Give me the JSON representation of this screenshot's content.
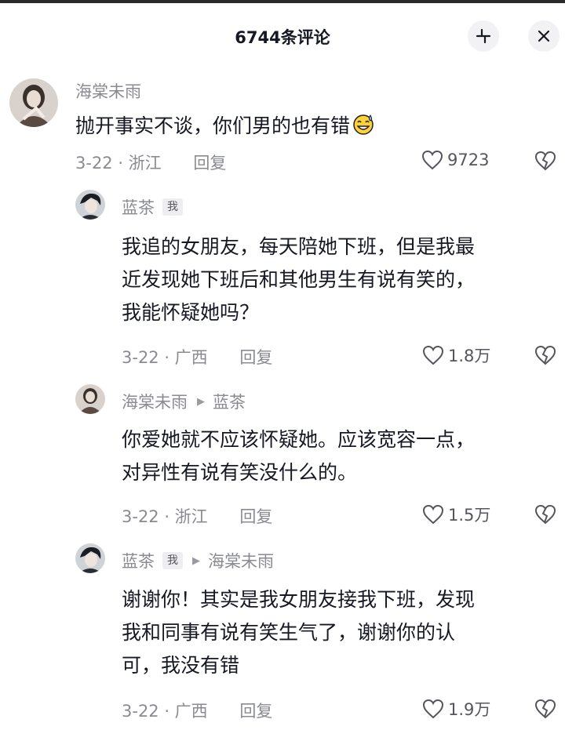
{
  "header": {
    "title": "6744条评论",
    "collapse_icon": "collapse-icon",
    "close_icon": "close-icon"
  },
  "comments": [
    {
      "user": "海棠未雨",
      "text": "抛开事实不谈，你们男的也有错",
      "emoji": "sweat-smile-emoji",
      "date": "3-22 · 浙江",
      "reply_label": "回复",
      "likes": "9723"
    },
    {
      "user": "蓝茶",
      "badge": "我",
      "text_lines": [
        "我追的女朋友，每天陪她下班，但是我最",
        "近发现她下班后和其他男生有说有笑的，",
        "我能怀疑她吗？"
      ],
      "date": "3-22 · 广西",
      "reply_label": "回复",
      "likes": "1.8万"
    },
    {
      "user": "海棠未雨",
      "reply_to": "蓝茶",
      "text_lines": [
        "你爱她就不应该怀疑她。应该宽容一点，",
        "对异性有说有笑没什么的。"
      ],
      "date": "3-22 · 浙江",
      "reply_label": "回复",
      "likes": "1.5万"
    },
    {
      "user": "蓝茶",
      "badge": "我",
      "reply_to": "海棠未雨",
      "text_lines": [
        "谢谢你！其实是我女朋友接我下班，发现",
        "我和同事有说有笑生气了，谢谢你的认",
        "可，我没有错"
      ],
      "date": "3-22 · 广西",
      "reply_label": "回复",
      "likes": "1.9万"
    }
  ],
  "icons": {
    "like": "heart-outline-icon",
    "dislike": "broken-heart-icon",
    "reply_arrow": "triangle-right-icon"
  },
  "colors": {
    "text_primary": "#161823",
    "text_secondary": "#8a8b91",
    "button_bg": "#f2f2f4"
  }
}
